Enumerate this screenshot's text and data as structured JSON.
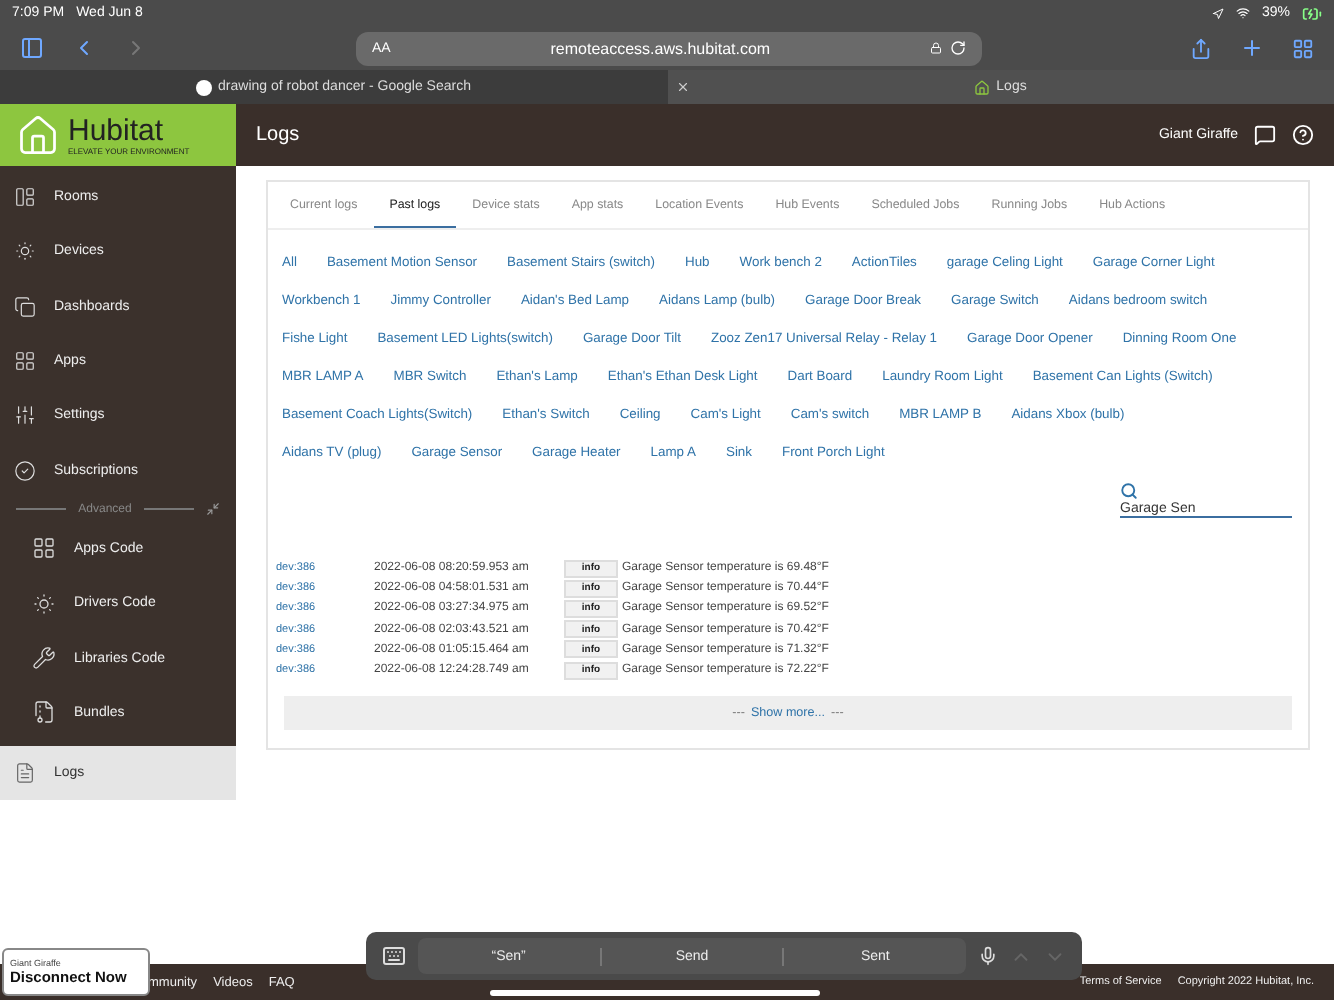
{
  "status_bar": {
    "time": "7:09 PM",
    "date": "Wed Jun 8",
    "battery": "39%"
  },
  "browser": {
    "text_size": "AA",
    "url": "remoteaccess.aws.hubitat.com",
    "tabs": [
      {
        "title": "drawing of robot dancer - Google Search",
        "selected": false
      },
      {
        "title": "Logs",
        "selected": true
      }
    ]
  },
  "logo": {
    "name": "Hubitat",
    "tagline": "ELEVATE YOUR ENVIRONMENT"
  },
  "header": {
    "title": "Logs",
    "user": "Giant Giraffe"
  },
  "sidebar": {
    "items": [
      {
        "label": "Rooms",
        "selected": false
      },
      {
        "label": "Devices",
        "selected": false
      },
      {
        "label": "Dashboards",
        "selected": false
      },
      {
        "label": "Apps",
        "selected": false
      },
      {
        "label": "Settings",
        "selected": false
      },
      {
        "label": "Subscriptions",
        "selected": false
      }
    ],
    "section_label": "Advanced",
    "advanced_items": [
      {
        "label": "Apps Code",
        "selected": false
      },
      {
        "label": "Drivers Code",
        "selected": false
      },
      {
        "label": "Libraries Code",
        "selected": false
      },
      {
        "label": "Bundles",
        "selected": false
      }
    ],
    "bottom_items": [
      {
        "label": "Logs",
        "selected": true
      }
    ]
  },
  "log_tabs": [
    {
      "label": "Current logs",
      "selected": false
    },
    {
      "label": "Past logs",
      "selected": true
    },
    {
      "label": "Device stats",
      "selected": false
    },
    {
      "label": "App stats",
      "selected": false
    },
    {
      "label": "Location Events",
      "selected": false
    },
    {
      "label": "Hub Events",
      "selected": false
    },
    {
      "label": "Scheduled Jobs",
      "selected": false
    },
    {
      "label": "Running Jobs",
      "selected": false
    },
    {
      "label": "Hub Actions",
      "selected": false
    }
  ],
  "device_filters": [
    "All",
    "Basement Motion Sensor",
    "Basement Stairs (switch)",
    "Hub",
    "Work bench 2",
    "ActionTiles",
    "garage Celing Light",
    "Garage Corner Light",
    "Workbench 1",
    "Jimmy Controller",
    "Aidan's Bed Lamp",
    "Aidans Lamp (bulb)",
    "Garage Door Break",
    "Garage Switch",
    "Aidans bedroom switch",
    "Fishe Light",
    "Basement LED Lights(switch)",
    "Garage Door Tilt",
    "Zooz Zen17 Universal Relay - Relay 1",
    "Garage Door Opener",
    "Dinning Room One",
    "MBR LAMP A",
    "MBR Switch",
    "Ethan's Lamp",
    "Ethan's Ethan Desk Light",
    "Dart Board",
    "Laundry Room Light",
    "Basement Can Lights (Switch)",
    "Basement Coach Lights(Switch)",
    "Ethan's Switch",
    "Ceiling",
    "Cam's Light",
    "Cam's switch",
    "MBR LAMP B",
    "Aidans Xbox (bulb)",
    "Aidans TV (plug)",
    "Garage Sensor",
    "Garage Heater",
    "Lamp A",
    "Sink",
    "Front Porch Light"
  ],
  "search": {
    "value": "Garage Sen"
  },
  "logs": [
    {
      "source": "dev:386",
      "time": "2022-06-08 08:20:59.953 am",
      "severity": "info",
      "message": "Garage Sensor temperature is 69.48°F"
    },
    {
      "source": "dev:386",
      "time": "2022-06-08 04:58:01.531 am",
      "severity": "info",
      "message": "Garage Sensor temperature is 70.44°F"
    },
    {
      "source": "dev:386",
      "time": "2022-06-08 03:27:34.975 am",
      "severity": "info",
      "message": "Garage Sensor temperature is 69.52°F"
    },
    {
      "source": "dev:386",
      "time": "2022-06-08 02:03:43.521 am",
      "severity": "info",
      "message": "Garage Sensor temperature is 70.42°F"
    },
    {
      "source": "dev:386",
      "time": "2022-06-08 01:05:15.464 am",
      "severity": "info",
      "message": "Garage Sensor temperature is 71.32°F"
    },
    {
      "source": "dev:386",
      "time": "2022-06-08 12:24:28.749 am",
      "severity": "info",
      "message": "Garage Sensor temperature is 72.22°F"
    }
  ],
  "show_more": {
    "dashes_left": "---",
    "label": "Show more...",
    "dashes_right": "---"
  },
  "footer": {
    "links": [
      "mmunity",
      "Videos",
      "FAQ"
    ],
    "terms": "Terms of Service",
    "copyright": "Copyright 2022 Hubitat, Inc."
  },
  "remote_banner": {
    "name": "Giant Giraffe",
    "button": "Disconnect Now"
  },
  "keyboard_bar": {
    "suggestions": [
      "“Sen”",
      "Send",
      "Sent"
    ],
    "arrows_disabled": true
  }
}
